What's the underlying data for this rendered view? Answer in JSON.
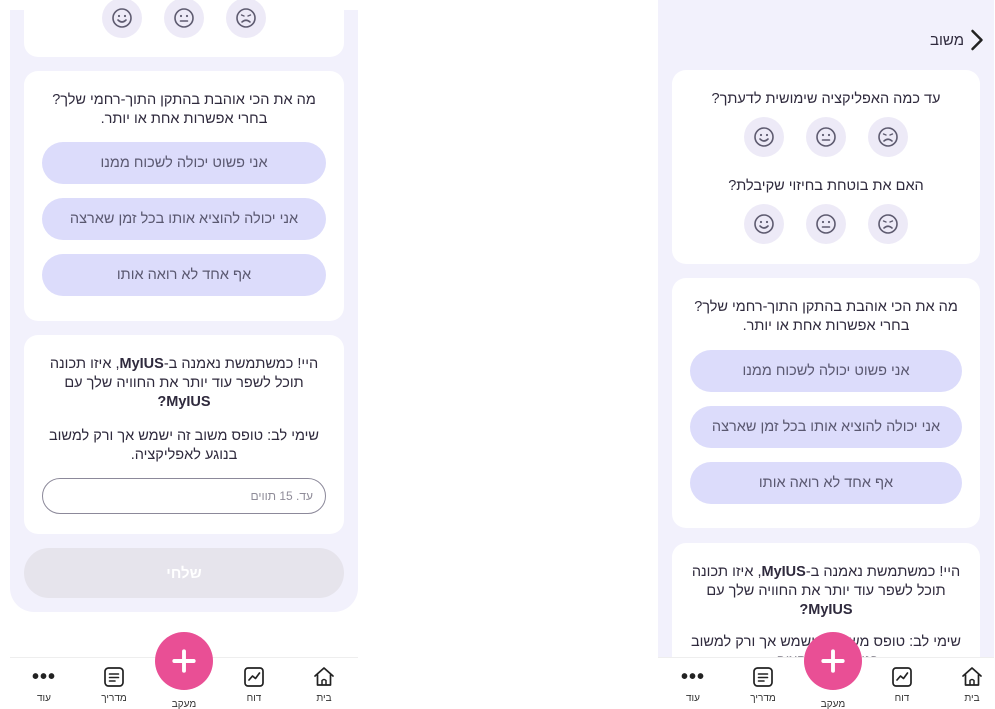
{
  "feedback": {
    "back_label": "משוב",
    "q1": "עד כמה האפליקציה שימושית לדעתך?",
    "q2": "האם את בוטחת בחיזוי שקיבלת?",
    "q3_line1": "מה את הכי אוהבת בהתקן התוך-רחמי שלך?",
    "q3_line2": "בחרי אפשרות אחת או יותר.",
    "options": [
      "אני פשוט יכולה לשכוח ממנו",
      "אני יכולה להוציא אותו בכל זמן שארצה",
      "אף אחד לא רואה אותו"
    ],
    "q4_pre": "היי! כמשתמשת נאמנה ב-",
    "q4_brand": "MyIUS",
    "q4_mid": ", איזו תכונה תוכל לשפר עוד יותר את החוויה שלך עם ",
    "q4_brand2": "MyIUS",
    "q4_end": "?",
    "note": "שימי לב: טופס משוב זה ישמש אך ורק למשוב בנוגע לאפליקציה.",
    "input_placeholder": "עד. 15 תווים",
    "submit_label": "שלחי"
  },
  "tabbar": {
    "home": "בית",
    "report": "דוח",
    "track": "מעקב",
    "guide": "מדריך",
    "more": "עוד"
  },
  "icons": {
    "emoji": [
      "happy-face-icon",
      "neutral-face-icon",
      "sad-face-icon"
    ],
    "tabs": [
      "home-icon",
      "chart-icon",
      "plus-icon",
      "document-icon",
      "more-dots-icon"
    ],
    "back": "chevron-right-icon"
  },
  "colors": {
    "accent_pink": "#e94f95",
    "option_bg": "#dcdcfb",
    "page_bg": "#f2f1fc",
    "submit_disabled": "#e6e4ec"
  }
}
